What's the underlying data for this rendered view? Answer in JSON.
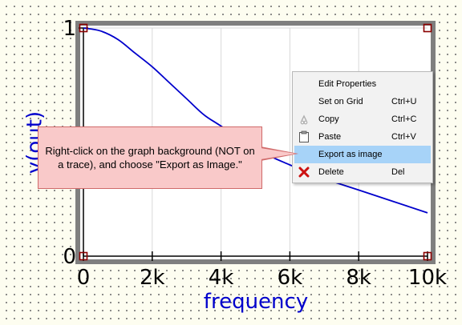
{
  "colors": {
    "background": "#fdfdf0",
    "trace": "#0000cc",
    "frame": "#7f7f7f",
    "handle": "#8b0000",
    "callout_fill": "#f9c9c9",
    "menu_highlight": "#a7d3f8"
  },
  "chart_data": {
    "type": "line",
    "xlabel": "frequency",
    "ylabel": "v(out)",
    "xlim": [
      0,
      10000
    ],
    "ylim": [
      0,
      1
    ],
    "x_ticks": [
      "0",
      "2k",
      "4k",
      "6k",
      "8k",
      "10k"
    ],
    "y_ticks": [
      "1",
      "0"
    ],
    "grid": true,
    "series": [
      {
        "x": [
          0,
          500,
          1000,
          1500,
          2000,
          2500,
          3000,
          3500,
          4000,
          5000,
          6000,
          7000,
          8000,
          9000,
          10000
        ],
        "values": [
          1.0,
          0.987,
          0.95,
          0.89,
          0.83,
          0.76,
          0.69,
          0.62,
          0.57,
          0.47,
          0.4,
          0.34,
          0.29,
          0.24,
          0.19
        ]
      }
    ]
  },
  "context_menu": {
    "items": [
      {
        "label": "Edit Properties",
        "shortcut": "",
        "icon": "none"
      },
      {
        "label": "Set on Grid",
        "shortcut": "Ctrl+U",
        "icon": "none"
      },
      {
        "label": "Copy",
        "shortcut": "Ctrl+C",
        "icon": "copy-icon"
      },
      {
        "label": "Paste",
        "shortcut": "Ctrl+V",
        "icon": "paste-icon"
      },
      {
        "label": "Export as image",
        "shortcut": "",
        "icon": "none",
        "highlighted": true
      },
      {
        "label": "Delete",
        "shortcut": "Del",
        "icon": "delete-icon"
      }
    ]
  },
  "callout": {
    "text": "Right-click on the graph background (NOT on a trace), and choose \"Export as Image.\""
  }
}
